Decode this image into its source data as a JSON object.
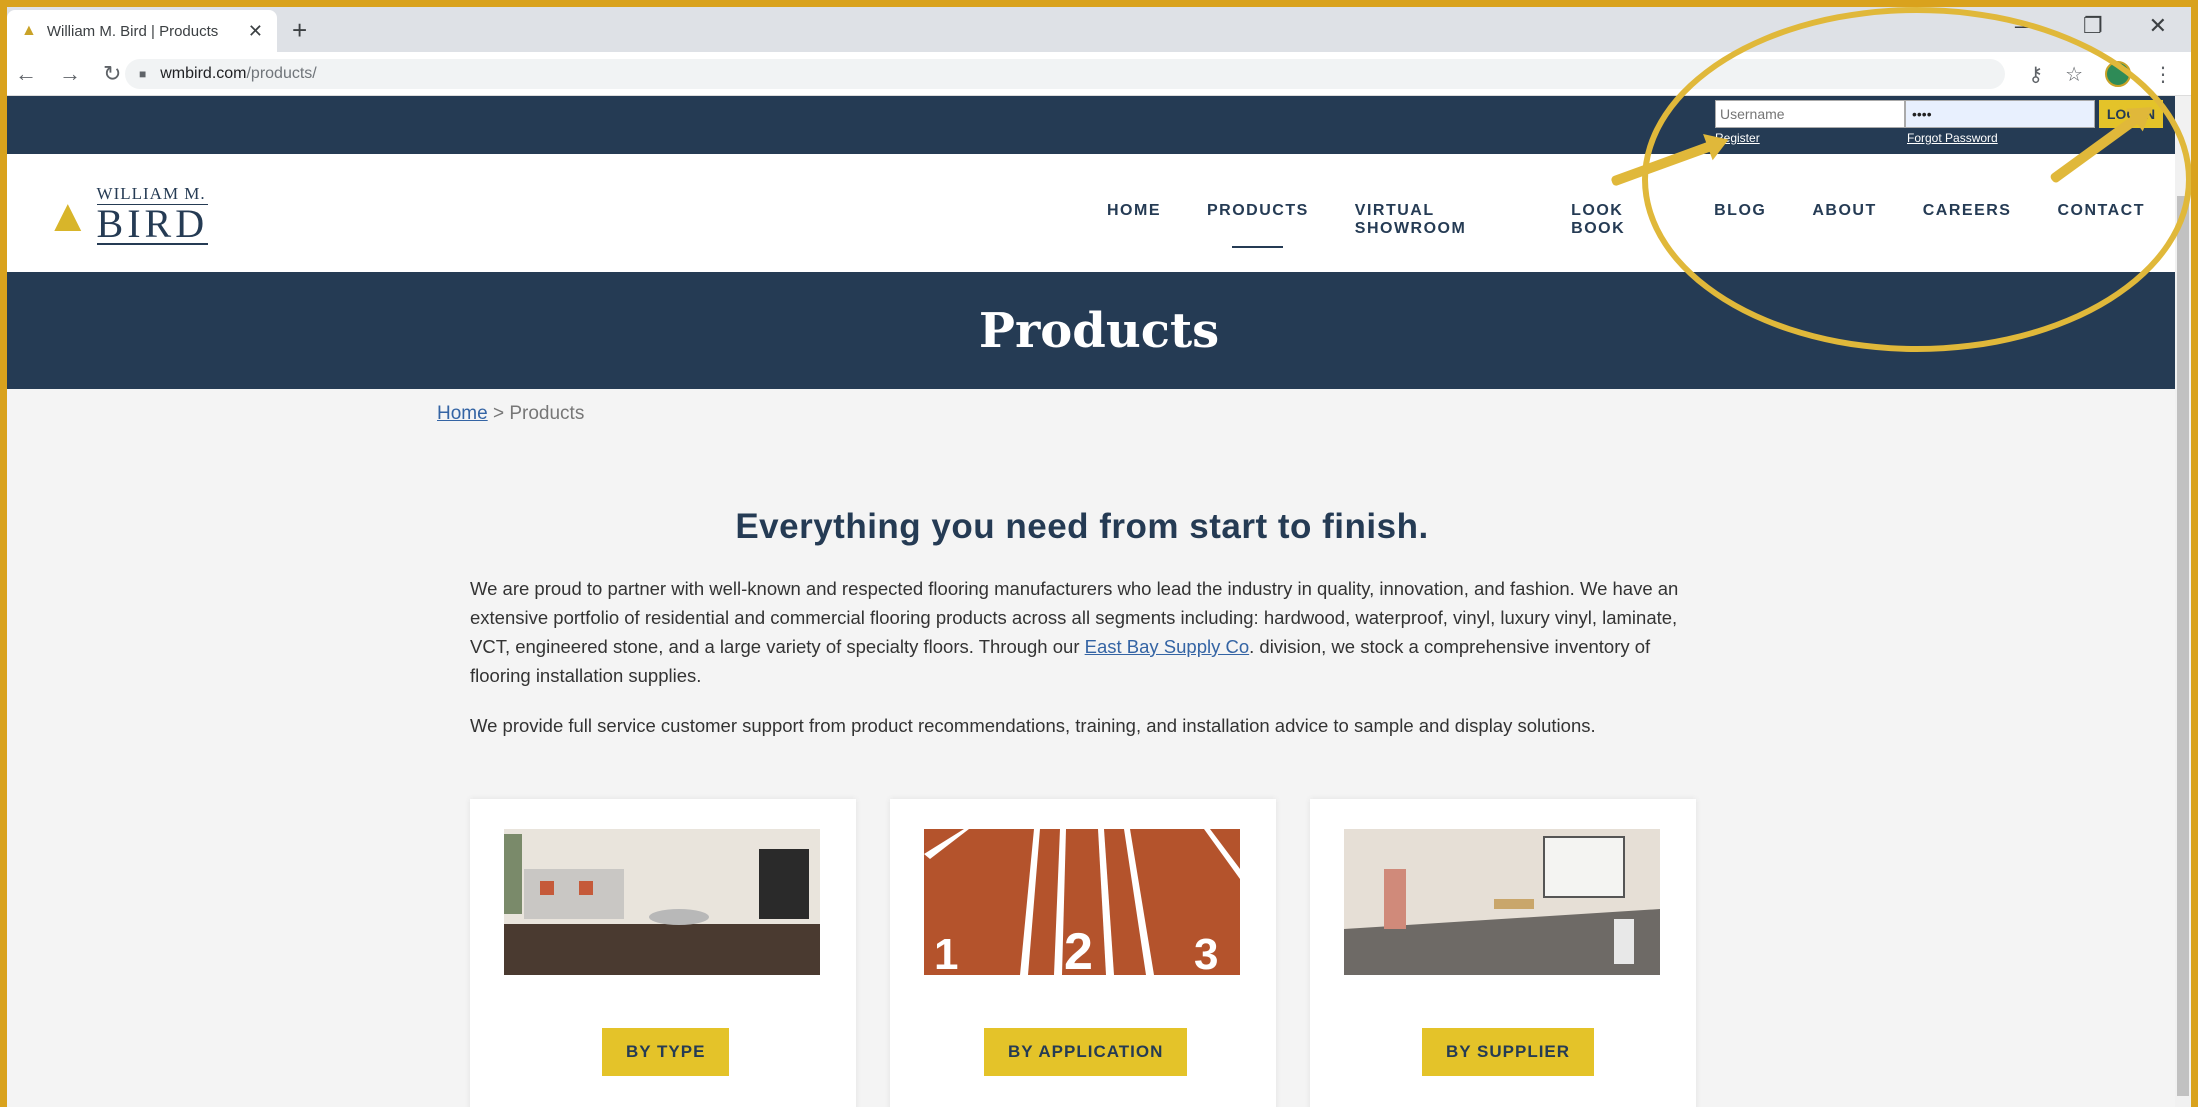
{
  "browser": {
    "tab_title": "William M. Bird | Products",
    "url_host": "wmbird.com",
    "url_path": "/products/"
  },
  "login": {
    "username_placeholder": "Username",
    "password_value": "••••",
    "button_label": "LOG IN",
    "register_label": "Register",
    "forgot_label": "Forgot Password"
  },
  "logo": {
    "line1": "WILLIAM M.",
    "line2": "BIRD"
  },
  "nav": [
    {
      "label": "HOME"
    },
    {
      "label": "PRODUCTS",
      "active": true
    },
    {
      "label": "VIRTUAL SHOWROOM"
    },
    {
      "label": "LOOK BOOK"
    },
    {
      "label": "BLOG"
    },
    {
      "label": "ABOUT"
    },
    {
      "label": "CAREERS"
    },
    {
      "label": "CONTACT"
    }
  ],
  "hero": {
    "title": "Products"
  },
  "breadcrumb": {
    "home": "Home",
    "current": " > Products"
  },
  "main": {
    "headline": "Everything you need from start to finish.",
    "p1_before": "We are proud to partner with well-known and respected flooring manufacturers who lead the industry in quality, innovation, and fashion.  We have an extensive portfolio of residential and commercial flooring products across all segments including:  hardwood, waterproof, vinyl, luxury vinyl, laminate, VCT, engineered stone, and a large variety of specialty floors.  Through our ",
    "p1_link": "East Bay Supply Co",
    "p1_after": ". division, we stock a comprehensive inventory of flooring installation supplies.",
    "p2": "We provide full service customer support from product recommendations, training, and installation advice to sample and display solutions."
  },
  "cards": [
    {
      "label": "BY TYPE"
    },
    {
      "label": "BY APPLICATION"
    },
    {
      "label": "BY SUPPLIER"
    }
  ],
  "colors": {
    "navy": "#253b54",
    "gold": "#e4c329",
    "annotation": "#e0b83a",
    "link": "#3464a4"
  }
}
